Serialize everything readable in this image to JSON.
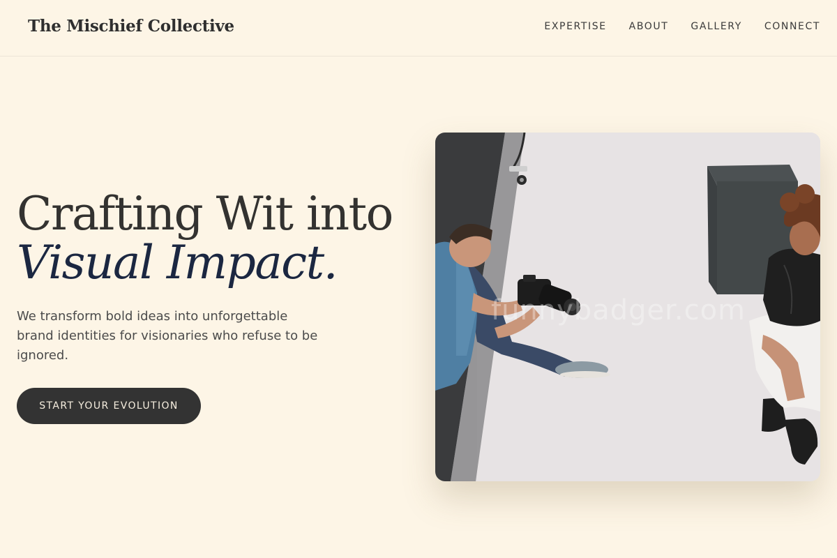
{
  "header": {
    "logo_text": "The Mischief Collective",
    "nav": [
      {
        "label": "EXPERTISE"
      },
      {
        "label": "ABOUT"
      },
      {
        "label": "GALLERY"
      },
      {
        "label": "CONNECT"
      }
    ]
  },
  "hero": {
    "heading_line1": "Crafting Wit into",
    "heading_line2": "Visual Impact.",
    "subtitle": "We transform bold ideas into unforgettable brand identities for visionaries who refuse to be ignored.",
    "cta_label": "START YOUR EVOLUTION",
    "photo": {
      "watermark": "funnybadger.com"
    }
  },
  "colors": {
    "background": "#fdf5e6",
    "text_dark": "#333230",
    "accent_navy": "#1b2741",
    "button_bg": "#333333",
    "button_text": "#f6eedf"
  }
}
